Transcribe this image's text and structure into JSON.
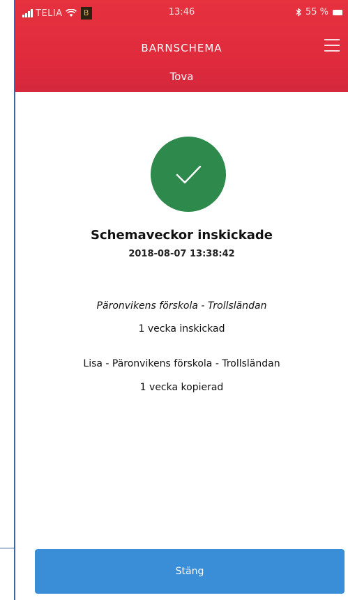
{
  "status_bar": {
    "carrier": "TELIA",
    "notification_glyph": "B",
    "time": "13:46",
    "battery": "55 %"
  },
  "header": {
    "app_title": "BARNSCHEMA",
    "child_name": "Tova"
  },
  "confirmation": {
    "title": "Schemaveckor inskickade",
    "timestamp": "2018-08-07 13:38:42",
    "submitted_school": "Päronvikens förskola - Trollsländan",
    "submitted_count": "1 vecka inskickad",
    "copied_school": "Lisa - Päronvikens förskola - Trollsländan",
    "copied_count": "1 vecka kopierad"
  },
  "actions": {
    "close_label": "Stäng"
  },
  "colors": {
    "header_bg": "#e0303e",
    "success_green": "#2e8a4c",
    "button_blue": "#3a8ed8"
  }
}
